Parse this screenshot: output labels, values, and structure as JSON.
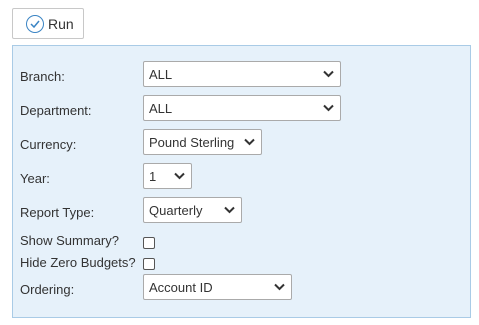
{
  "toolbar": {
    "run_label": "Run",
    "accent_color": "#3a84c4"
  },
  "form": {
    "panel_bg": "#e6f1fa",
    "fields": {
      "branch": {
        "label": "Branch:",
        "value": "ALL"
      },
      "department": {
        "label": "Department:",
        "value": "ALL"
      },
      "currency": {
        "label": "Currency:",
        "value": "Pound Sterling"
      },
      "year": {
        "label": "Year:",
        "value": "1"
      },
      "report_type": {
        "label": "Report Type:",
        "value": "Quarterly"
      },
      "show_summary": {
        "label": "Show Summary?",
        "checked": false
      },
      "hide_zero_budgets": {
        "label": "Hide Zero Budgets?",
        "checked": false
      },
      "ordering": {
        "label": "Ordering:",
        "value": "Account ID"
      }
    }
  },
  "icons": {
    "run": "check-circle-icon",
    "dropdown": "chevron-down-icon"
  }
}
